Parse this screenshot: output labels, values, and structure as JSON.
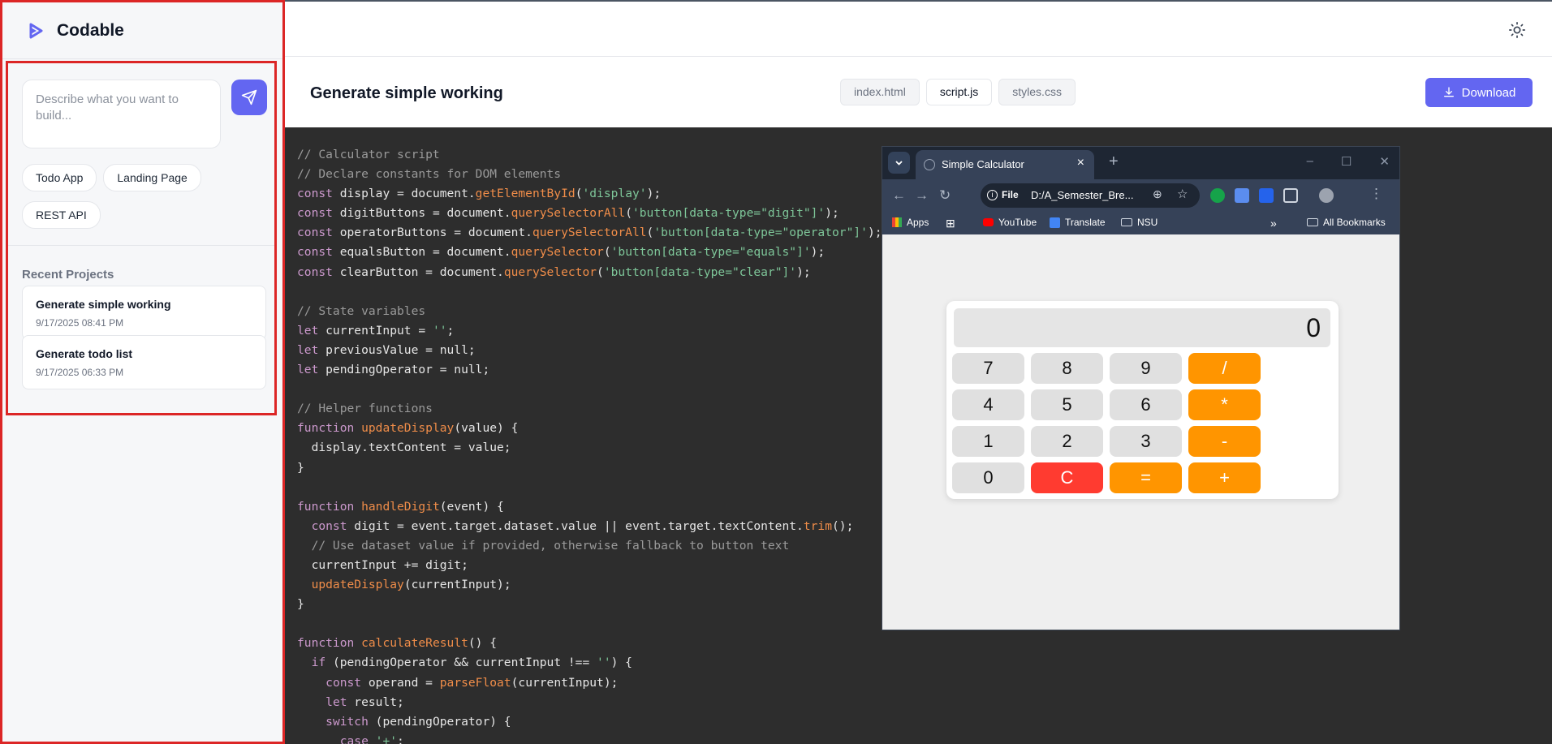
{
  "app": {
    "name": "Codable",
    "accent": "#6366f1"
  },
  "sidebar": {
    "prompt_placeholder": "Describe what you want to build...",
    "chips": [
      "Todo App",
      "Landing Page",
      "REST API"
    ],
    "recent_title": "Recent Projects",
    "projects": [
      {
        "title": "Generate simple working",
        "date": "9/17/2025 08:41 PM"
      },
      {
        "title": "Generate todo list",
        "date": "9/17/2025 06:33 PM"
      }
    ]
  },
  "header": {
    "title": "Generate simple working",
    "tabs": [
      "index.html",
      "script.js",
      "styles.css"
    ],
    "active_tab": "script.js",
    "download_label": "Download"
  },
  "browser": {
    "tab_title": "Simple Calculator",
    "url_scheme": "File",
    "url": "D:/A_Semester_Bre...",
    "bookmarks": [
      "Apps",
      "YouTube",
      "Translate",
      "NSU"
    ],
    "all_bookmarks": "All Bookmarks",
    "more": "»"
  },
  "calculator": {
    "display": "0",
    "keys": [
      [
        "7",
        "8",
        "9",
        "/"
      ],
      [
        "4",
        "5",
        "6",
        "*"
      ],
      [
        "1",
        "2",
        "3",
        "-"
      ],
      [
        "0",
        "C",
        "=",
        "+"
      ]
    ]
  },
  "code_lines": [
    "// Calculator script",
    "// Declare constants for DOM elements",
    "const display = document.getElementById('display');",
    "const digitButtons = document.querySelectorAll('button[data-type=\"digit\"]');",
    "const operatorButtons = document.querySelectorAll('button[data-type=\"operator\"]');",
    "const equalsButton = document.querySelector('button[data-type=\"equals\"]');",
    "const clearButton = document.querySelector('button[data-type=\"clear\"]');",
    "",
    "// State variables",
    "let currentInput = '';",
    "let previousValue = null;",
    "let pendingOperator = null;",
    "",
    "// Helper functions",
    "function updateDisplay(value) {",
    "  display.textContent = value;",
    "}",
    "",
    "function handleDigit(event) {",
    "  const digit = event.target.dataset.value || event.target.textContent.trim();",
    "  // Use dataset value if provided, otherwise fallback to button text",
    "  currentInput += digit;",
    "  updateDisplay(currentInput);",
    "}",
    "",
    "function calculateResult() {",
    "  if (pendingOperator && currentInput !== '') {",
    "    const operand = parseFloat(currentInput);",
    "    let result;",
    "    switch (pendingOperator) {",
    "      case '+':"
  ]
}
